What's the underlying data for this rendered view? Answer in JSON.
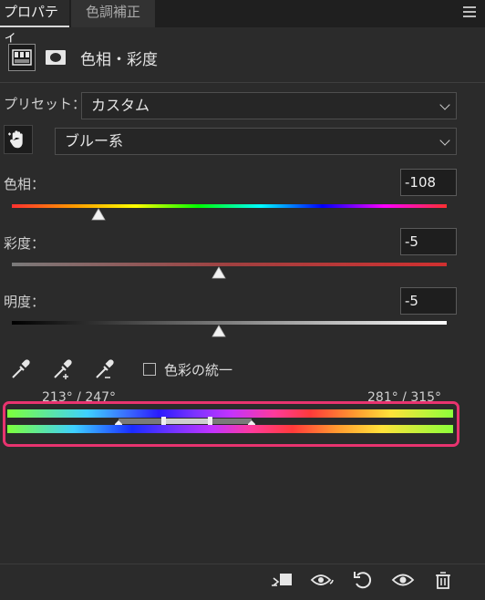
{
  "tabs": [
    {
      "label": "プロパティ"
    },
    {
      "label": "色調補正"
    }
  ],
  "panel": {
    "title": "色相・彩度"
  },
  "preset": {
    "label": "プリセット：",
    "value": "カスタム"
  },
  "channel": {
    "value": "ブルー系"
  },
  "hue": {
    "label": "色相：",
    "value": "-108",
    "slider": -108,
    "min": -180,
    "max": 180
  },
  "saturation": {
    "label": "彩度：",
    "value": "-5",
    "slider": -5,
    "min": -100,
    "max": 100
  },
  "lightness": {
    "label": "明度：",
    "value": "-5",
    "slider": -5,
    "min": -100,
    "max": 100
  },
  "colorize": {
    "label": "色彩の統一",
    "checked": false
  },
  "range": {
    "left": "213° / 247°",
    "right": "281° / 315°"
  },
  "colors": {
    "highlight": "#e8336f",
    "panel_bg": "#2b2b2b",
    "tab_bg": "#1f1f1f"
  },
  "icons": {
    "tools": [
      "eyedropper-icon",
      "eyedropper-add-icon",
      "eyedropper-subtract-icon"
    ],
    "bottom": [
      "clip-to-layer-icon",
      "view-previous-state-icon",
      "reset-icon",
      "visibility-eye-icon",
      "trash-icon"
    ]
  }
}
